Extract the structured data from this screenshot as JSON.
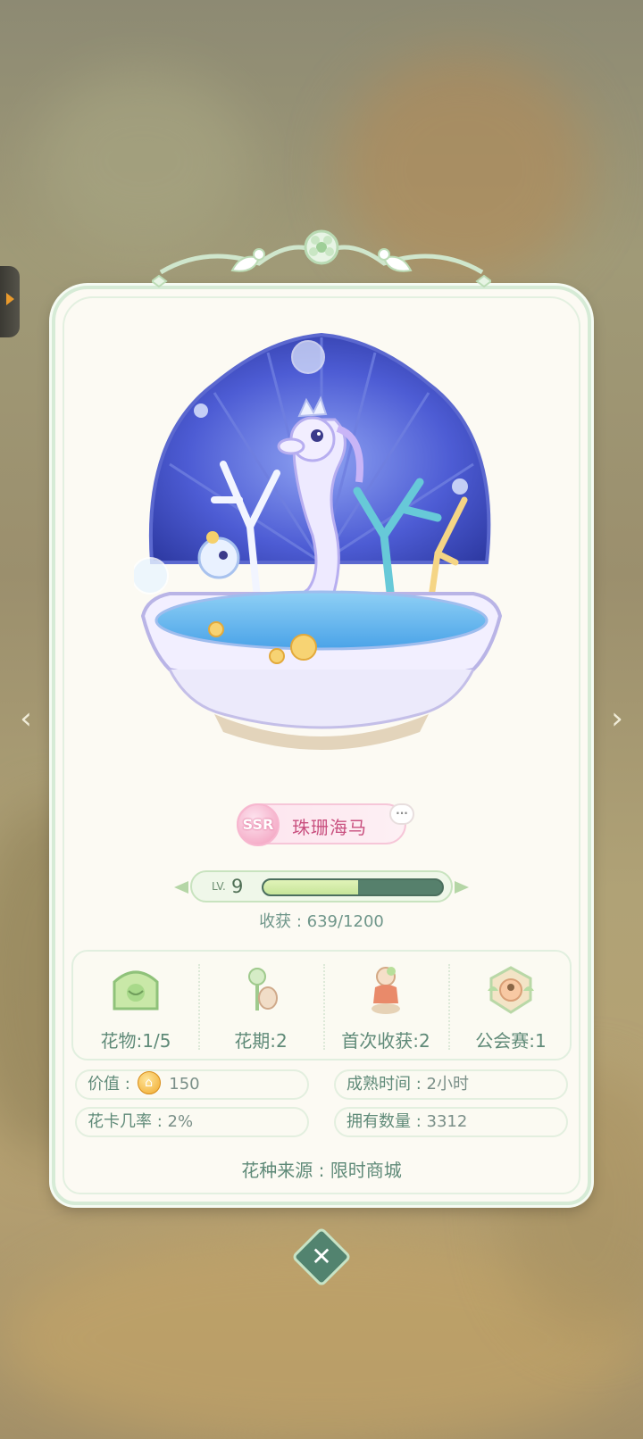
{
  "flower": {
    "rarity": "SSR",
    "name": "珠珊海马"
  },
  "level": {
    "label": "LV.",
    "value": "9",
    "progress_fraction": 0.53
  },
  "harvest_text": "收获 : 639/1200",
  "stats": [
    {
      "label": "花物:1/5",
      "icon": "flower-frame-icon"
    },
    {
      "label": "花期:2",
      "icon": "flower-bud-icon"
    },
    {
      "label": "首次收获:2",
      "icon": "harvest-doll-icon"
    },
    {
      "label": "公会赛:1",
      "icon": "guild-emblem-icon"
    }
  ],
  "info": {
    "value_label": "价值 :",
    "value_amount": "150",
    "mature_label": "成熟时间 :",
    "mature_value": "2小时",
    "card_rate_label": "花卡几率 :",
    "card_rate_value": "2%",
    "owned_label": "拥有数量 :",
    "owned_value": "3312"
  },
  "source_text": "花种来源 :  限时商城",
  "nav": {
    "prev": "‹",
    "next": "›",
    "close": "✕"
  },
  "colors": {
    "accent_green": "#52836f",
    "text_green": "#5f8a78",
    "ssr_pink": "#c9507f"
  }
}
